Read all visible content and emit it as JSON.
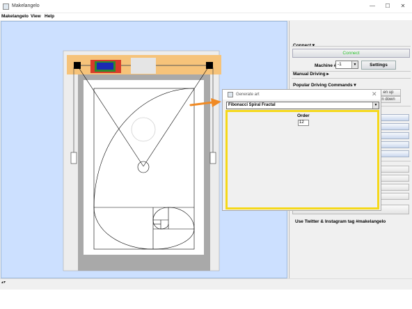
{
  "window": {
    "title": "Makelangelo",
    "minimize": "—",
    "maximize": "☐",
    "close": "✕"
  },
  "menu": {
    "items": [
      "Makelangelo",
      "View",
      "Help"
    ]
  },
  "right_panel": {
    "connect_header": "Connect ▾",
    "connect_button": "Connect",
    "connect_color": "#2ec42e",
    "machine_label": "Machine #",
    "machine_value": "-1",
    "settings_button": "Settings",
    "manual_driving_header": "Manual Driving ▸",
    "popular_commands_header": "Popular Driving Commands ▾",
    "pen_up_label": "en up",
    "pen_down_label": "n down",
    "hashtag": "Use Twitter & Instagram tag #makelangelo"
  },
  "dialog": {
    "title": "Generate art",
    "selected_generator": "Fibonacci Spiral Fractal",
    "order_label": "Order",
    "order_value": "12",
    "highlight_color": "#f5d81a",
    "arrow_color": "#f08a24"
  },
  "bottom": {
    "scroll_hint": "▴▾"
  }
}
